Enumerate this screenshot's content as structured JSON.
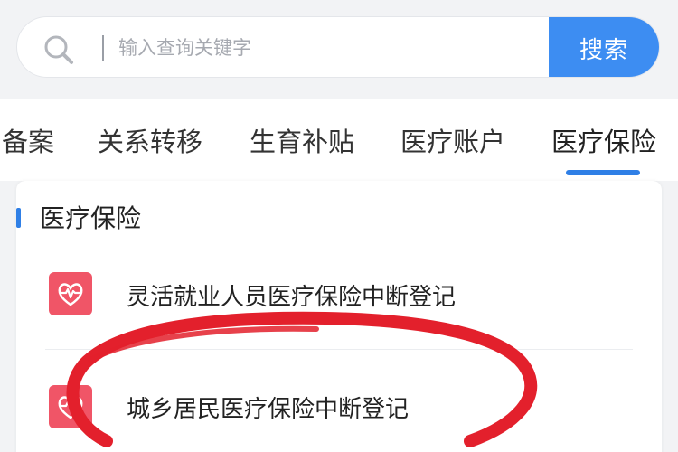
{
  "search": {
    "placeholder": "输入查询关键字",
    "button_label": "搜索"
  },
  "tabs": [
    {
      "label": "备案"
    },
    {
      "label": "关系转移"
    },
    {
      "label": "生育补贴"
    },
    {
      "label": "医疗账户"
    },
    {
      "label": "医疗保险",
      "active": true
    }
  ],
  "section": {
    "title": "医疗保险",
    "items": [
      {
        "label": "灵活就业人员医疗保险中断登记",
        "icon": "heart-pulse-icon"
      },
      {
        "label": "城乡居民医疗保险中断登记",
        "icon": "heart-pulse-icon"
      }
    ]
  },
  "colors": {
    "accent": "#3d8df2",
    "icon_bg": "#f05567",
    "annotation": "#e3202c"
  }
}
